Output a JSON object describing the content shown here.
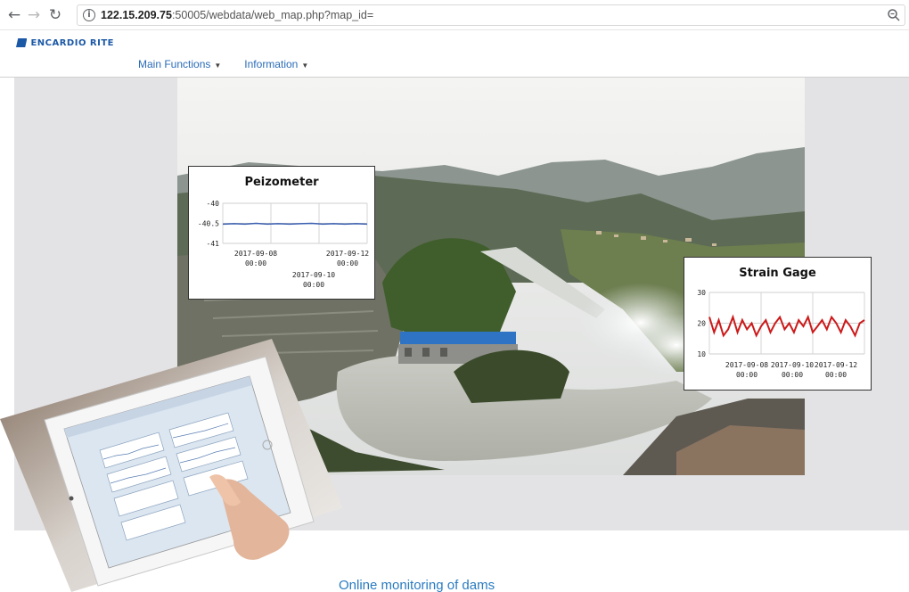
{
  "browser": {
    "url_host": "122.15.209.75",
    "url_path": ":50005/webdata/web_map.php?map_id="
  },
  "site": {
    "logo_text": "ENCARDIO RITE",
    "menu": [
      {
        "label": "Main Functions"
      },
      {
        "label": "Information"
      }
    ]
  },
  "chart_data": [
    {
      "type": "line",
      "title": "Peizometer",
      "ylim": [
        -41,
        -40
      ],
      "y_ticks": [
        "-40",
        "-40.5",
        "-41"
      ],
      "x_ticks": [
        "2017-09-08",
        "2017-09-10",
        "2017-09-12"
      ],
      "x_tick_times": [
        "00:00",
        "00:00",
        "00:00"
      ],
      "series": [
        {
          "color": "#3a5fb0",
          "values": [
            -40.52,
            -40.51,
            -40.52,
            -40.5,
            -40.52,
            -40.51,
            -40.52,
            -40.51,
            -40.5,
            -40.52,
            -40.51,
            -40.52,
            -40.51,
            -40.52
          ]
        }
      ],
      "grid": true
    },
    {
      "type": "line",
      "title": "Strain Gage",
      "ylim": [
        10,
        30
      ],
      "y_ticks": [
        "30",
        "20",
        "10"
      ],
      "x_ticks": [
        "2017-09-08",
        "2017-09-10",
        "2017-09-12"
      ],
      "x_tick_times": [
        "00:00",
        "00:00",
        "00:00"
      ],
      "series": [
        {
          "color": "#cc1a1a",
          "values": [
            22,
            17,
            21,
            16,
            18,
            22,
            17,
            21,
            18,
            20,
            16,
            19,
            21,
            17,
            20,
            22,
            18,
            20,
            17,
            21,
            19,
            22,
            17,
            19,
            21,
            18,
            22,
            20,
            17,
            21,
            19,
            16,
            20,
            21
          ]
        }
      ],
      "grid": true
    }
  ],
  "caption": "Online monitoring of dams",
  "colors": {
    "accent": "#2a6bb8",
    "page_bg": "#e3e3e5",
    "caption": "#2a7bc0"
  }
}
